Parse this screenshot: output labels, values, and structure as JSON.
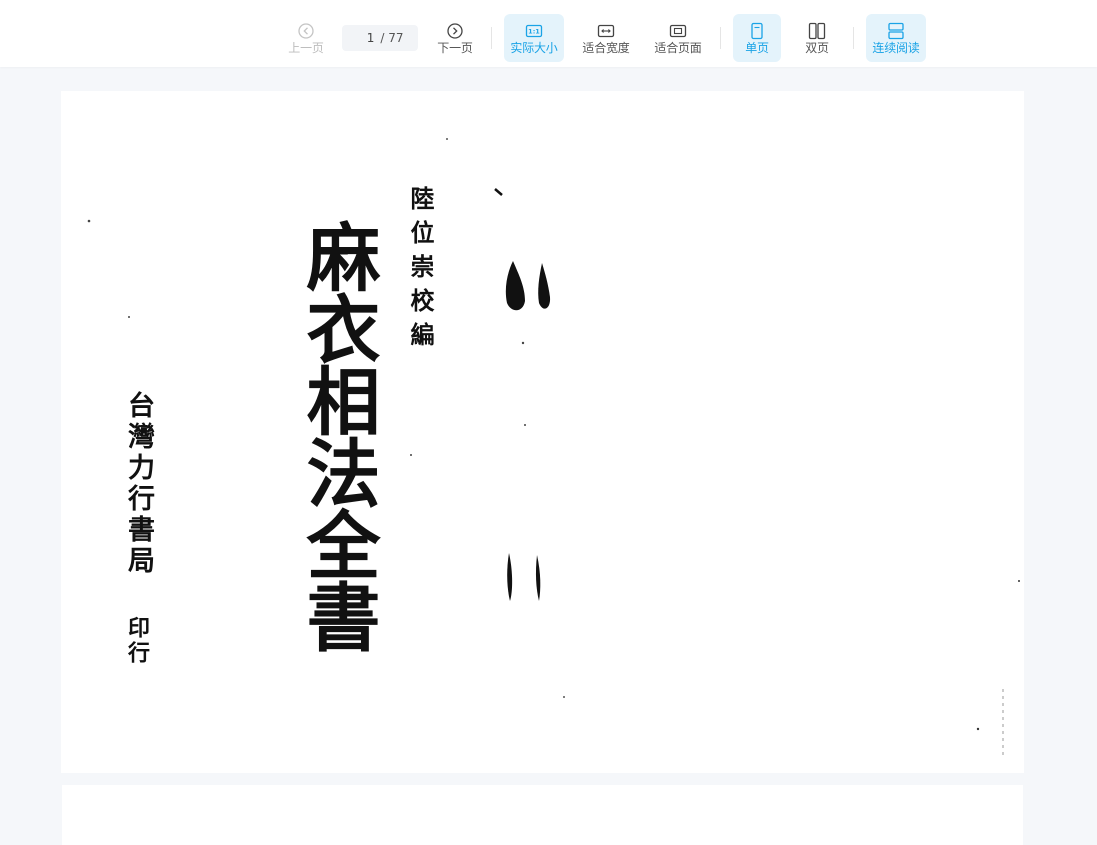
{
  "toolbar": {
    "prev": {
      "label": "上一页",
      "icon": "chevron-left-circle-icon",
      "disabled": true
    },
    "page_current": "1",
    "page_total": "/ 77",
    "next": {
      "label": "下一页",
      "icon": "chevron-right-circle-icon"
    },
    "actual_size": {
      "label": "实际大小",
      "icon": "actual-size-icon",
      "icon_text": "1:1",
      "active": true
    },
    "fit_width": {
      "label": "适合宽度",
      "icon": "fit-width-icon"
    },
    "fit_page": {
      "label": "适合页面",
      "icon": "fit-page-icon"
    },
    "single_page": {
      "label": "单页",
      "icon": "single-page-icon",
      "active": true
    },
    "double_page": {
      "label": "双页",
      "icon": "double-page-icon"
    },
    "continuous": {
      "label": "连续阅读",
      "icon": "continuous-read-icon",
      "active": true
    }
  },
  "document": {
    "title": "麻衣相法全書",
    "editor": "陸位崇校編",
    "publisher": "台灣力行書局",
    "publisher_suffix": "印行"
  },
  "colors": {
    "accent": "#1aa3e6",
    "active_bg": "#e4f3fb",
    "viewer_bg": "#f5f7fa"
  }
}
